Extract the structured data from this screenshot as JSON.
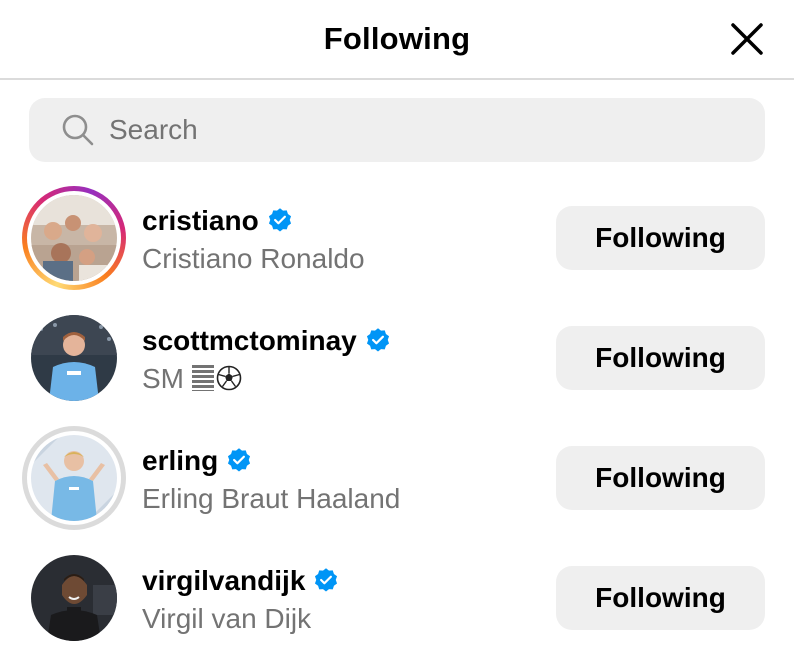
{
  "modal": {
    "title": "Following"
  },
  "search": {
    "placeholder": "Search",
    "value": ""
  },
  "accounts": [
    {
      "username": "cristiano",
      "full_name": "Cristiano Ronaldo",
      "verified": true,
      "has_story_ring": true,
      "button_label": "Following"
    },
    {
      "username": "scottmctominay",
      "full_name": "SM",
      "full_name_icons": [
        "menu-lines-icon",
        "soccer-ball-icon"
      ],
      "verified": true,
      "has_story_ring": false,
      "button_label": "Following"
    },
    {
      "username": "erling",
      "full_name": "Erling Braut Haaland",
      "verified": true,
      "has_story_ring": false,
      "button_label": "Following"
    },
    {
      "username": "virgilvandijk",
      "full_name": "Virgil van Dijk",
      "verified": true,
      "has_story_ring": false,
      "button_label": "Following"
    }
  ],
  "colors": {
    "verified_blue": "#0095f6",
    "secondary_text": "#737373",
    "button_background": "#efefef",
    "divider": "#dbdbdb"
  }
}
